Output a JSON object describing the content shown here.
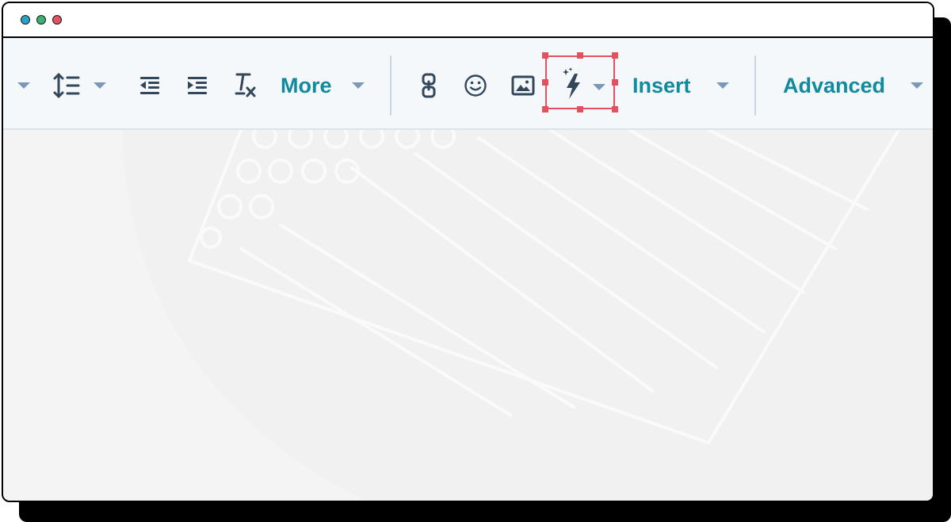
{
  "window": {
    "controls": [
      {
        "name": "minimize",
        "color": "#2aa4c4"
      },
      {
        "name": "maximize",
        "color": "#3bb273"
      },
      {
        "name": "close",
        "color": "#e0525f"
      }
    ]
  },
  "toolbar": {
    "more_label": "More",
    "insert_label": "Insert",
    "advanced_label": "Advanced",
    "icons": [
      "dropdown-caret-icon",
      "line-height-icon",
      "outdent-icon",
      "indent-icon",
      "clear-formatting-icon",
      "link-icon",
      "emoji-icon",
      "image-icon",
      "ai-lightning-icon"
    ],
    "selected_tool": "ai-lightning-icon"
  },
  "colors": {
    "accent": "#0f8a9e",
    "icon": "#33475b",
    "caret": "#7c98b6",
    "highlight": "#e0525f",
    "toolbar_bg": "#f5f8fa",
    "canvas_bg": "#f4f4f4"
  }
}
